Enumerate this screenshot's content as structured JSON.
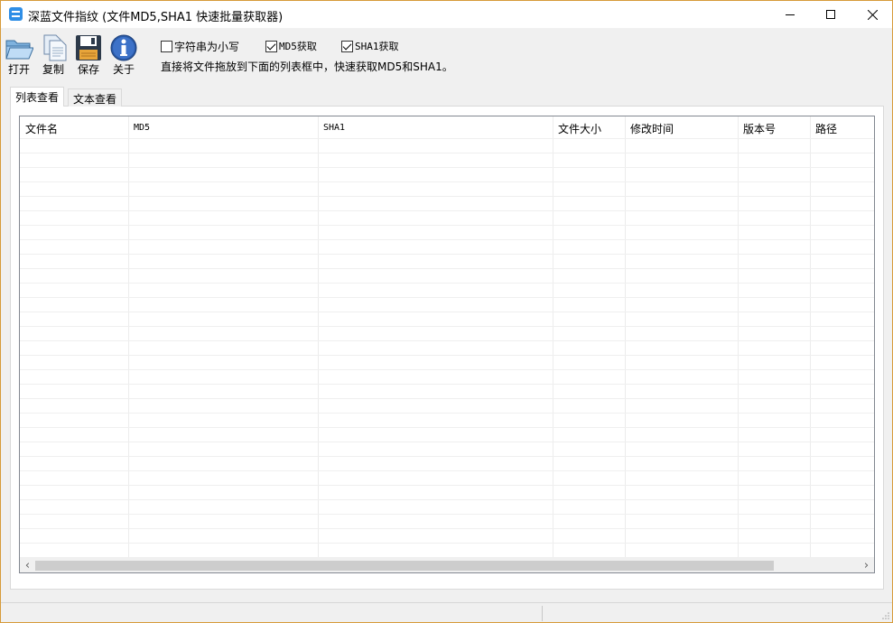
{
  "window": {
    "title": "深蓝文件指纹 (文件MD5,SHA1 快速批量获取器)"
  },
  "toolbar": {
    "open_label": "打开",
    "copy_label": "复制",
    "save_label": "保存",
    "about_label": "关于"
  },
  "options": {
    "lowercase": {
      "label": "字符串为小写",
      "checked": false
    },
    "md5": {
      "label": "MD5获取",
      "checked": true
    },
    "sha1": {
      "label": "SHA1获取",
      "checked": true
    },
    "hint": "直接将文件拖放到下面的列表框中，快速获取MD5和SHA1。"
  },
  "tabs": [
    {
      "label": "列表查看",
      "active": true
    },
    {
      "label": "文本查看",
      "active": false
    }
  ],
  "list": {
    "columns": [
      "文件名",
      "MD5",
      "SHA1",
      "文件大小",
      "修改时间",
      "版本号",
      "路径"
    ],
    "rows": []
  },
  "colors": {
    "accent": "#2f8ee6",
    "window_border": "#d79b3a",
    "background": "#f0f0f0"
  }
}
